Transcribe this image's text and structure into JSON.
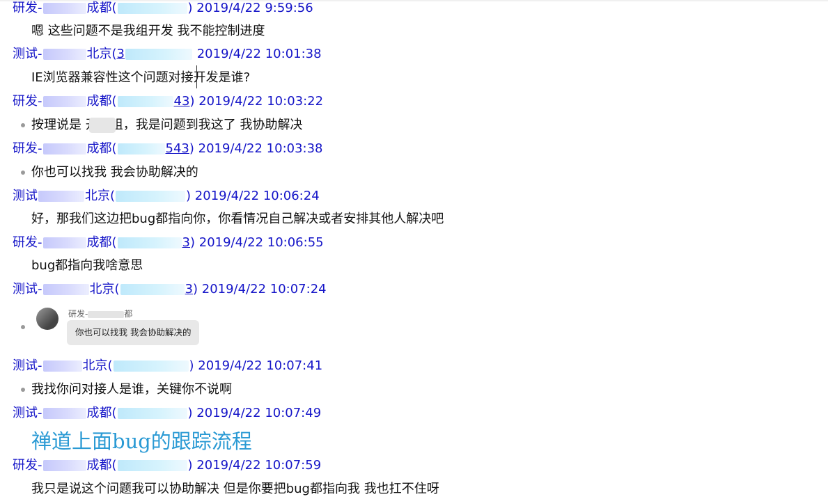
{
  "messages": [
    {
      "sender_prefix": "研发-",
      "sender_city": "成都(",
      "sender_num_tail": "",
      "close": ")",
      "time": "2019/4/22 9:59:56",
      "text": "嗯  这些问题不是我组开发    我不能控制进度",
      "bullet": false
    },
    {
      "sender_prefix": "测试-",
      "sender_city": "北京(",
      "sender_num_tail": "3",
      "close": ")",
      "time": "2019/4/22 10:01:38",
      "text": "IE浏览器兼容性这个问题对接开发是谁?",
      "bullet": false
    },
    {
      "sender_prefix": "研发-",
      "sender_city": "成都(",
      "sender_num_tail": "43",
      "close": ")",
      "time": "2019/4/22 10:03:22",
      "text": "按理说是   开发组，我是问题到我这了  我协助解决",
      "bullet": true
    },
    {
      "sender_prefix": "研发-",
      "sender_city": "成都(",
      "sender_num_tail": "543",
      "close": ")",
      "time": "2019/4/22 10:03:38",
      "text": "你也可以找我  我会协助解决的",
      "bullet": true
    },
    {
      "sender_prefix": "测试",
      "sender_city": "北京(",
      "sender_num_tail": "",
      "close": ")",
      "time": "2019/4/22 10:06:24",
      "text": "好，那我们这边把bug都指向你，你看情况自己解决或者安排其他人解决吧",
      "bullet": false
    },
    {
      "sender_prefix": "研发-",
      "sender_city": "成都(",
      "sender_num_tail": "3",
      "close": ")",
      "time": "2019/4/22 10:06:55",
      "text": "bug都指向我啥意思",
      "bullet": false
    },
    {
      "sender_prefix": "测试-",
      "sender_city": "北京(",
      "sender_num_tail": "3",
      "close": ")",
      "time": "2019/4/22 10:07:24",
      "text": "",
      "bullet": true
    },
    {
      "sender_prefix": "测试-",
      "sender_city": "北京(",
      "sender_num_tail": "",
      "close": ")",
      "time": "2019/4/22 10:07:41",
      "text": "我找你问对接人是谁，关键你不说啊",
      "bullet": true
    },
    {
      "sender_prefix": "测试-",
      "sender_city": "成都(",
      "sender_num_tail": "",
      "close": ")",
      "time": "2019/4/22 10:07:49",
      "text": "",
      "bullet": false
    },
    {
      "sender_prefix": "研发-",
      "sender_city": "成都(",
      "sender_num_tail": "",
      "close": ")",
      "time": "2019/4/22 10:07:59",
      "text": "我只是说这个问题我可以协助解决  但是你要把bug都指向我  我也扛不住呀",
      "bullet": false
    }
  ],
  "quote": {
    "name": "研发-",
    "name_tail": "都",
    "text": "你也可以找我  我会协助解决的"
  },
  "big_text": "禅道上面bug的跟踪流程",
  "colors": {
    "sender": "#1515c8",
    "link": "#2a9ad4",
    "text": "#111111"
  }
}
